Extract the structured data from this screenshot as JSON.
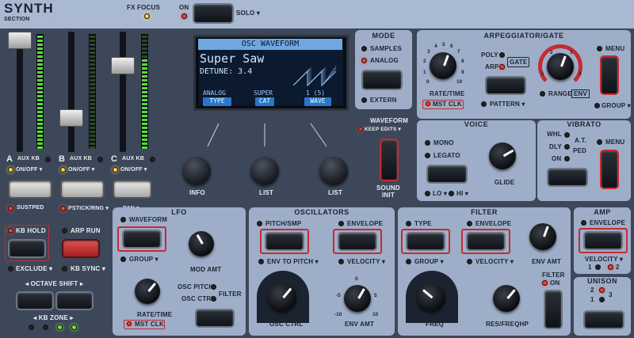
{
  "header": {
    "title": "SYNTH",
    "subtitle": "SECTION",
    "fx_focus": "FX FOCUS",
    "on": "ON",
    "solo": "SOLO ▾"
  },
  "display": {
    "title": "OSC WAVEFORM",
    "name": "Super Saw",
    "param": "DETUNE: 3.4",
    "fields": [
      "ANALOG",
      "SUPER",
      "1 (5)"
    ],
    "tags": [
      "TYPE",
      "CAT",
      "WAVE"
    ]
  },
  "knob_labels": {
    "info": "INFO",
    "list1": "LIST",
    "list2": "LIST"
  },
  "mode": {
    "title": "MODE",
    "samples": "SAMPLES",
    "analog": "ANALOG",
    "extern": "EXTERN"
  },
  "waveform": {
    "title": "WAVEFORM",
    "keep": "KEEP EDITS ▾",
    "sound_init": "SOUND",
    "init": "INIT"
  },
  "layers": [
    {
      "name": "A",
      "aux": "AUX KB",
      "onoff": "ON/OFF ▾",
      "foot": "SUSTPED"
    },
    {
      "name": "B",
      "aux": "AUX KB",
      "onoff": "ON/OFF ▾",
      "foot": "PSTICK/RNG ▾"
    },
    {
      "name": "C",
      "aux": "AUX KB",
      "onoff": "ON/OFF ▾",
      "foot": "PAN ▾"
    }
  ],
  "arp": {
    "title": "ARPEGGIATOR/GATE",
    "poly": "POLY",
    "arp": "ARP",
    "gate": "GATE",
    "rate": "RATE/TIME",
    "mst": "MST CLK",
    "pattern": "PATTERN ▾",
    "range": "RANGE",
    "env": "ENV",
    "menu": "MENU",
    "group": "GROUP ▾",
    "scale": [
      "0",
      "1",
      "2",
      "3",
      "4",
      "5",
      "6",
      "7",
      "8",
      "9",
      "10"
    ],
    "range_scale": [
      "1",
      "2",
      "3",
      "4"
    ]
  },
  "voice": {
    "title": "VOICE",
    "mono": "MONO",
    "legato": "LEGATO",
    "glide": "GLIDE",
    "lo": "LO ▾",
    "hi": "HI ▾"
  },
  "vibrato": {
    "title": "VIBRATO",
    "whl": "WHL",
    "at": "A.T.",
    "dly": "DLY",
    "ped": "PED",
    "on": "ON",
    "menu": "MENU"
  },
  "left": {
    "kbhold": "KB HOLD",
    "arprun": "ARP RUN",
    "exclude": "EXCLUDE ▾",
    "kbsync": "KB SYNC ▾",
    "octave": "◂ OCTAVE SHIFT ▸",
    "kbzone": "◂ KB ZONE ▸"
  },
  "lfo": {
    "title": "LFO",
    "waveform": "WAVEFORM",
    "group": "GROUP ▾",
    "rate": "RATE/TIME",
    "mst": "MST CLK",
    "mod": "MOD AMT",
    "osc_pitch": "OSC PITCH",
    "osc_ctrl": "OSC CTRL",
    "filter": "FILTER"
  },
  "osc": {
    "title": "OSCILLATORS",
    "pitch": "PITCH/SMP",
    "envelope": "ENVELOPE",
    "env_to_pitch": "ENV TO PITCH ▾",
    "velocity": "VELOCITY ▾",
    "osc_ctrl": "OSC CTRL",
    "env_amt": "ENV AMT",
    "bip": [
      "-5",
      "-10",
      "0",
      "5",
      "10"
    ]
  },
  "filter": {
    "title": "FILTER",
    "type": "TYPE",
    "envelope": "ENVELOPE",
    "group": "GROUP ▾",
    "velocity": "VELOCITY ▾",
    "env_amt": "ENV AMT",
    "filter_on": "FILTER",
    "on": "ON",
    "freq": "FREQ",
    "res": "RES/FREQHP"
  },
  "amp": {
    "title": "AMP",
    "envelope": "ENVELOPE",
    "velocity": "VELOCITY ▾",
    "v1": "1",
    "v2": "2"
  },
  "unison": {
    "title": "UNISON",
    "n1": "1",
    "n2": "2",
    "n3": "3"
  }
}
